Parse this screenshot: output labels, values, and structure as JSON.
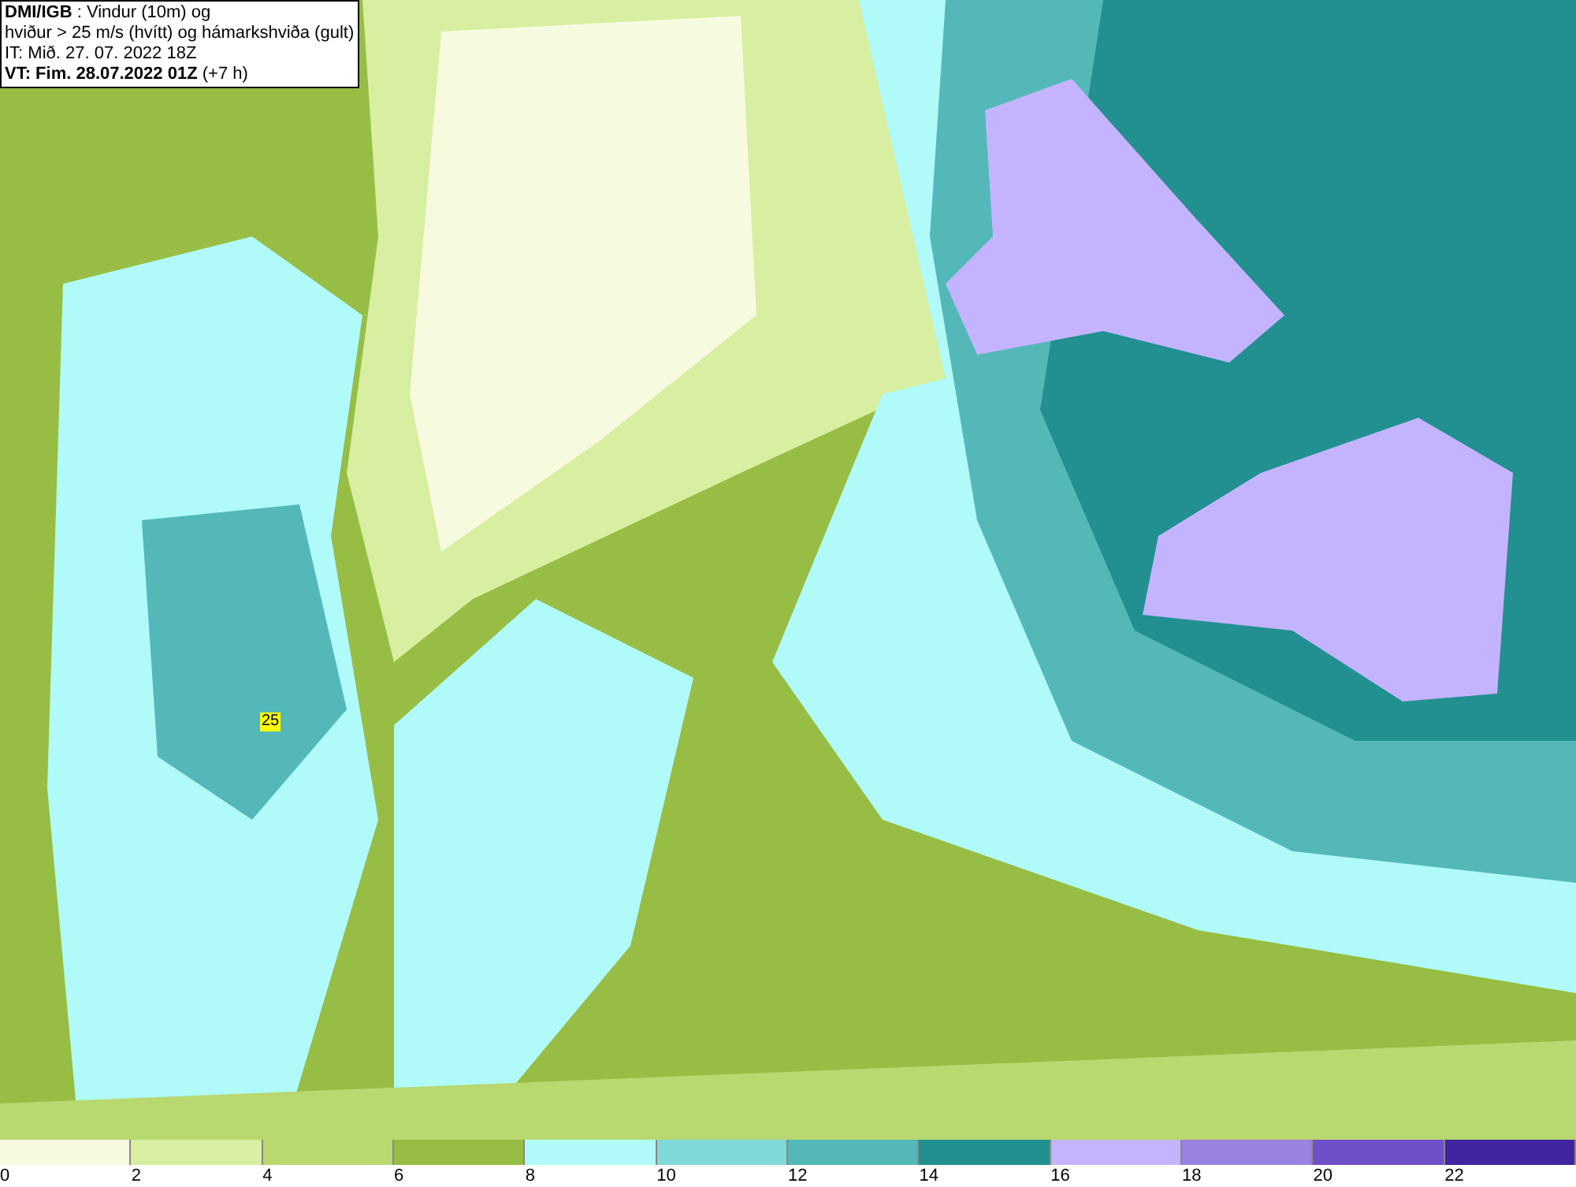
{
  "header": {
    "lines": [
      "**DMI/IGB** : Vindur (10m) og",
      "hviður > 25 m/s (hvítt) og hámarkshviða (gult)",
      "IT: Mið. 27. 07. 2022 18Z",
      "**VT: Fim. 28.07.2022 01Z** (+7 h)"
    ]
  },
  "gust_marker": {
    "value": "25"
  },
  "legend": [
    {
      "label": "0",
      "color": "#f6fbdf"
    },
    {
      "label": "2",
      "color": "#d8eea0"
    },
    {
      "label": "4",
      "color": "#b8d870"
    },
    {
      "label": "6",
      "color": "#98bd45"
    },
    {
      "label": "8",
      "color": "#b0fafa"
    },
    {
      "label": "10",
      "color": "#80d8d8"
    },
    {
      "label": "12",
      "color": "#55b8b8"
    },
    {
      "label": "14",
      "color": "#229090"
    },
    {
      "label": "16",
      "color": "#c4b4ff"
    },
    {
      "label": "18",
      "color": "#9a82e0"
    },
    {
      "label": "20",
      "color": "#7050c8"
    },
    {
      "label": "22",
      "color": "#4024a0"
    }
  ]
}
